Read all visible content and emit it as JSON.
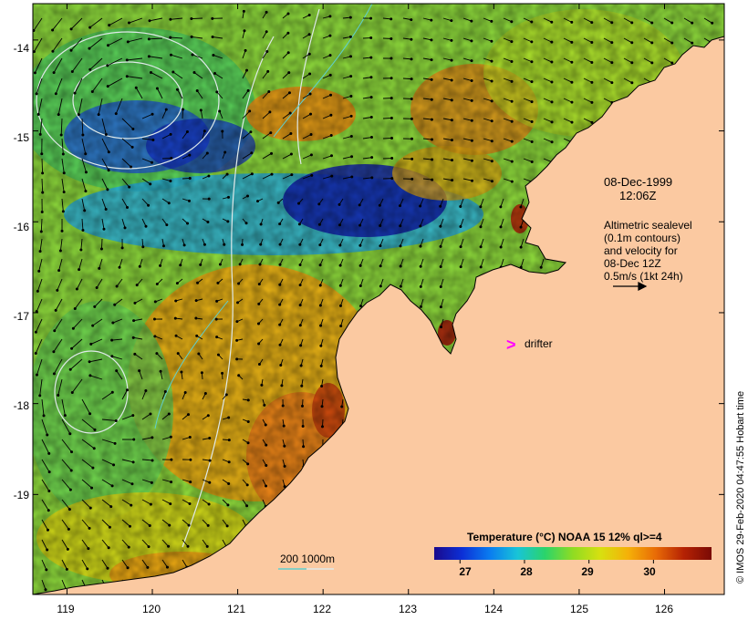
{
  "map": {
    "date": "08-Dec-1999",
    "time": "12:06Z",
    "note_lines": [
      "Altimetric sealevel",
      "(0.1m contours)",
      "and velocity for",
      "08-Dec 12Z",
      "0.5m/s (1kt 24h)"
    ],
    "drifter_symbol": ">",
    "drifter_label": "drifter",
    "colorbar_title": "Temperature (°C) NOAA 15 12% ql>=4",
    "colorbar_ticks": [
      "27",
      "28",
      "29",
      "30"
    ],
    "colorbar_range": [
      26.6,
      30.9
    ],
    "depth_legend": "200  1000m",
    "credit": "© IMOS 29-Feb-2020 04:47:55 Hobart time",
    "x_ticks": [
      "119",
      "120",
      "121",
      "122",
      "123",
      "124",
      "125",
      "126"
    ],
    "y_ticks": [
      "-14",
      "-15",
      "-16",
      "-17",
      "-18",
      "-19"
    ],
    "lon_range": [
      118.6,
      126.7
    ],
    "lat_range": [
      -20.1,
      -13.6
    ],
    "colors": {
      "land": "#fbc9a1",
      "coast": "#000000",
      "drifter": "#ff00ff",
      "contour": "#dfe9e9",
      "bathy_200": "#5fcfcf"
    },
    "palette": [
      "#1a0a8c",
      "#0c2fd6",
      "#0a7cf0",
      "#18c4d8",
      "#2bd46a",
      "#8fdc22",
      "#d8e010",
      "#f5b008",
      "#e86a06",
      "#b52204",
      "#7a0a05"
    ]
  }
}
